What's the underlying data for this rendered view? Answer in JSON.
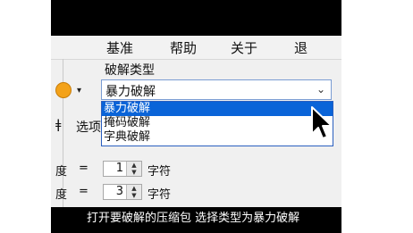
{
  "menu": {
    "items": [
      "基准",
      "帮助",
      "关于",
      "退"
    ]
  },
  "crack_type": {
    "title": "破解类型",
    "selected": "暴力破解",
    "options": [
      "暴力破解",
      "掩码破解",
      "字典破解"
    ]
  },
  "tabs": {
    "partial_left": "ǂ",
    "options_tab": "选项"
  },
  "length": {
    "row1": {
      "label": "度",
      "equals": "=",
      "value": "1",
      "unit": "字符"
    },
    "row2": {
      "label": "度",
      "equals": "=",
      "value": "3",
      "unit": "字符"
    }
  },
  "caption": "打开要破解的压缩包 选择类型为暴力破解",
  "colors": {
    "accent": "#0a64d8",
    "caption_bg": "#000000"
  }
}
